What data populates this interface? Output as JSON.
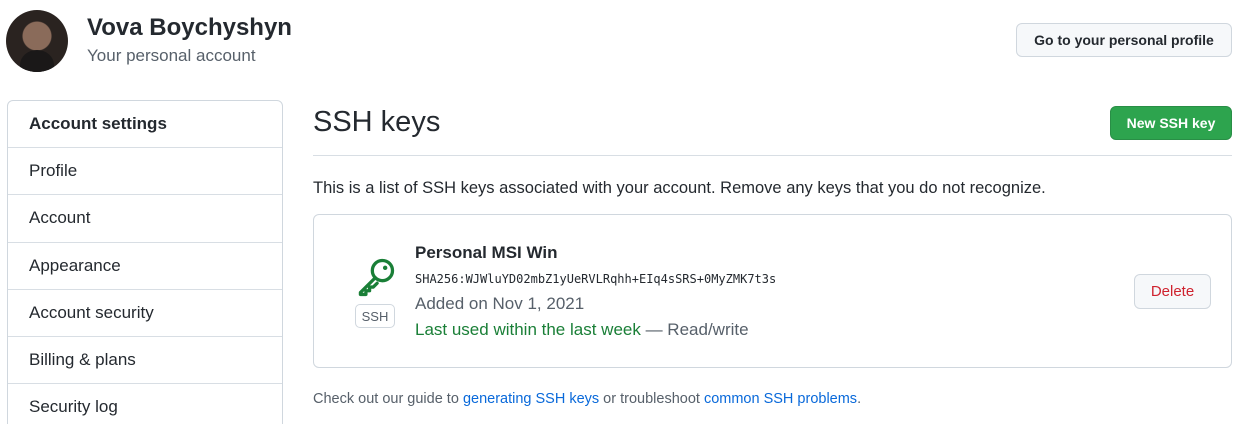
{
  "user": {
    "name": "Vova Boychyshyn",
    "subtitle": "Your personal account"
  },
  "header": {
    "profile_button": "Go to your personal profile"
  },
  "sidebar": {
    "items": [
      {
        "label": "Account settings"
      },
      {
        "label": "Profile"
      },
      {
        "label": "Account"
      },
      {
        "label": "Appearance"
      },
      {
        "label": "Account security"
      },
      {
        "label": "Billing & plans"
      },
      {
        "label": "Security log"
      }
    ]
  },
  "main": {
    "title": "SSH keys",
    "new_button": "New SSH key",
    "description": "This is a list of SSH keys associated with your account. Remove any keys that you do not recognize.",
    "key": {
      "icon": "key-icon",
      "badge": "SSH",
      "title": "Personal MSI Win",
      "fingerprint": "SHA256:WJWluYD02mbZ1yUeRVLRqhh+EIq4sSRS+0MyZMK7t3s",
      "added": "Added on Nov 1, 2021",
      "last_used": "Last used within the last week",
      "access": " — Read/write",
      "delete_button": "Delete"
    },
    "footer": {
      "prefix": "Check out our guide to ",
      "link1": "generating SSH keys",
      "middle": " or troubleshoot ",
      "link2": "common SSH problems",
      "suffix": "."
    }
  },
  "colors": {
    "primary_button": "#2da44e",
    "key_icon": "#1a7f37",
    "link": "#0969da",
    "danger": "#cf222e"
  }
}
